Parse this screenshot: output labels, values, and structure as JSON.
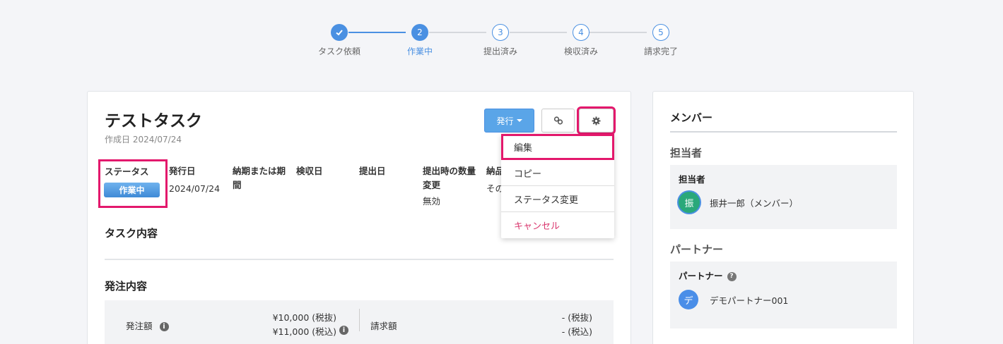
{
  "stepper": {
    "steps": [
      {
        "label": "タスク依頼",
        "number": "",
        "state": "done"
      },
      {
        "label": "作業中",
        "number": "2",
        "state": "current"
      },
      {
        "label": "提出済み",
        "number": "3",
        "state": "todo"
      },
      {
        "label": "検収済み",
        "number": "4",
        "state": "todo"
      },
      {
        "label": "請求完了",
        "number": "5",
        "state": "todo"
      }
    ]
  },
  "task": {
    "title": "テストタスク",
    "created": "作成日 2024/07/24",
    "issue_button": "発行",
    "dropdown": [
      "編集",
      "コピー",
      "ステータス変更",
      "キャンセル"
    ],
    "fields": {
      "status": {
        "label": "ステータス",
        "value": "作業中"
      },
      "issue_date": {
        "label": "発行日",
        "value": "2024/07/24"
      },
      "deadline": {
        "label": "納期または期間",
        "value": ""
      },
      "inspection_date": {
        "label": "検収日",
        "value": ""
      },
      "submit_date": {
        "label": "提出日",
        "value": ""
      },
      "qty_change": {
        "label": "提出時の数量変更",
        "value": "無効"
      },
      "delivery": {
        "label": "納品",
        "value": "その"
      }
    },
    "task_content_title": "タスク内容",
    "order_title": "発注内容",
    "order": {
      "order_amount_label": "発注額",
      "order_amount_excl": "¥10,000 (税抜)",
      "order_amount_incl": "¥11,000 (税込)",
      "invoice_label": "請求額",
      "invoice_excl": "- (税抜)",
      "invoice_incl": "- (税込)"
    }
  },
  "members": {
    "title": "メンバー",
    "assignee_section": "担当者",
    "assignee_box_title": "担当者",
    "assignee_avatar": "振",
    "assignee_name": "振井一郎（メンバー）",
    "partner_section": "パートナー",
    "partner_box_title": "パートナー",
    "partner_avatar": "デ",
    "partner_name": "デモパートナー001"
  },
  "colors": {
    "accent": "#4a90e2",
    "highlight": "#e3186c",
    "cancel": "#d9376e"
  }
}
